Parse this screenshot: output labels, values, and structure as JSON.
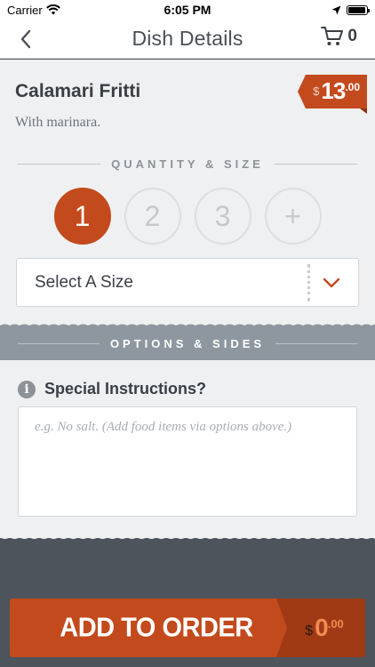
{
  "status_bar": {
    "carrier": "Carrier",
    "time": "6:05 PM",
    "battery_level": 0.95
  },
  "nav": {
    "title": "Dish Details",
    "back_icon": "chevron-left-icon",
    "cart_icon": "cart-icon",
    "cart_count": "0"
  },
  "dish": {
    "name": "Calamari Fritti",
    "description": "With marinara.",
    "price_currency": "$",
    "price_main": "13",
    "price_cents": ".00"
  },
  "quantity_size": {
    "label": "QUANTITY & SIZE",
    "options": [
      "1",
      "2",
      "3",
      "+"
    ],
    "selected": "1",
    "size_placeholder": "Select A Size"
  },
  "options_sides": {
    "label": "OPTIONS & SIDES"
  },
  "instructions": {
    "title": "Special Instructions?",
    "placeholder": "e.g. No salt. (Add food items via options above.)"
  },
  "order": {
    "button_label": "ADD TO ORDER",
    "total_currency": "$",
    "total_main": "0",
    "total_cents": ".00"
  },
  "colors": {
    "accent": "#c34a1c",
    "accent_dark": "#9f3a14",
    "band": "#8e979f",
    "footer": "#4d545c"
  }
}
